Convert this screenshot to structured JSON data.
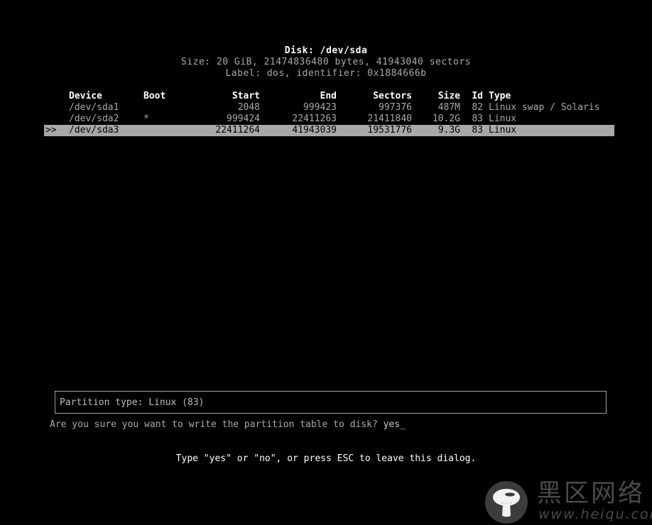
{
  "disk": {
    "title": "Disk: /dev/sda",
    "size_line": "Size: 20 GiB, 21474836480 bytes, 41943040 sectors",
    "label_line": "Label: dos, identifier: 0x1884666b"
  },
  "table": {
    "columns": {
      "marker": "",
      "device": "Device",
      "boot": "Boot",
      "start": "Start",
      "end": "End",
      "sectors": "Sectors",
      "size": "Size",
      "id": "Id",
      "type": "Type"
    },
    "rows": [
      {
        "marker": "",
        "device": "/dev/sda1",
        "boot": "",
        "start": "2048",
        "end": "999423",
        "sectors": "997376",
        "size": "487M",
        "id": "82",
        "type": "Linux swap / Solaris",
        "selected": false
      },
      {
        "marker": "",
        "device": "/dev/sda2",
        "boot": "*",
        "start": "999424",
        "end": "22411263",
        "sectors": "21411840",
        "size": "10.2G",
        "id": "83",
        "type": "Linux",
        "selected": false
      },
      {
        "marker": ">>",
        "device": "/dev/sda3",
        "boot": "",
        "start": "22411264",
        "end": "41943039",
        "sectors": "19531776",
        "size": "9.3G",
        "id": "83",
        "type": "Linux",
        "selected": true
      }
    ]
  },
  "dialog": {
    "info_text": "Partition type: Linux (83)",
    "prompt_question": "Are you sure you want to write the partition table to disk? ",
    "prompt_answer": "yes",
    "cursor": "_",
    "hint": "Type \"yes\" or \"no\", or press ESC to leave this dialog."
  },
  "watermark": {
    "icon": "mushroom-icon",
    "brand_cn": "黑区网络",
    "url": "www.heiqu.com"
  },
  "colors": {
    "background": "#000000",
    "text": "#aaaaaa",
    "header_text": "#ffffff",
    "selection_bg": "#a8a8a8",
    "selection_text": "#000000",
    "box_border": "#a0a0a0",
    "watermark": "#4a4a4a"
  }
}
